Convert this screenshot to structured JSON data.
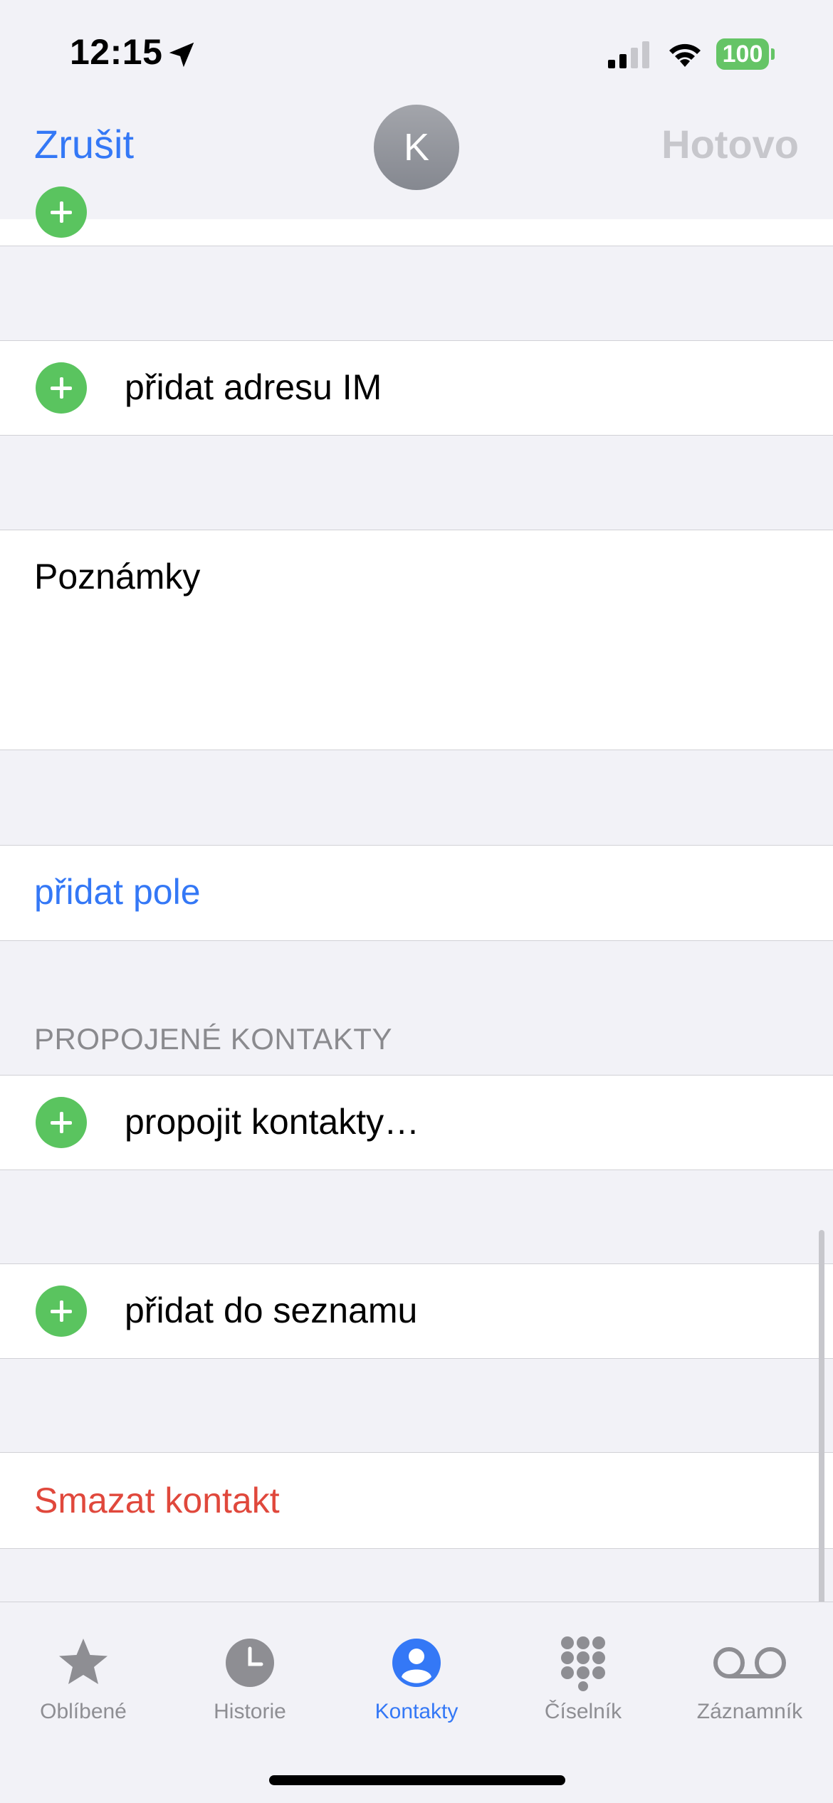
{
  "status_bar": {
    "time": "12:15",
    "battery": "100"
  },
  "nav": {
    "cancel_label": "Zrušit",
    "avatar_initial": "K",
    "done_label": "Hotovo"
  },
  "rows": {
    "add_im": "přidat adresu IM",
    "notes_label": "Poznámky",
    "add_field": "přidat pole",
    "linked_header": "PROPOJENÉ KONTAKTY",
    "link_contacts": "propojit kontakty…",
    "add_to_list": "přidat do seznamu",
    "delete_contact": "Smazat kontakt"
  },
  "tabs": [
    {
      "label": "Oblíbené",
      "icon": "star-icon",
      "active": false
    },
    {
      "label": "Historie",
      "icon": "clock-icon",
      "active": false
    },
    {
      "label": "Kontakty",
      "icon": "person-circle-icon",
      "active": true
    },
    {
      "label": "Číselník",
      "icon": "keypad-icon",
      "active": false
    },
    {
      "label": "Záznamník",
      "icon": "voicemail-icon",
      "active": false
    }
  ],
  "colors": {
    "accent": "#3478f6",
    "destructive": "#e0483c",
    "add_green": "#5ac45f",
    "disabled": "#c7c7cc"
  }
}
